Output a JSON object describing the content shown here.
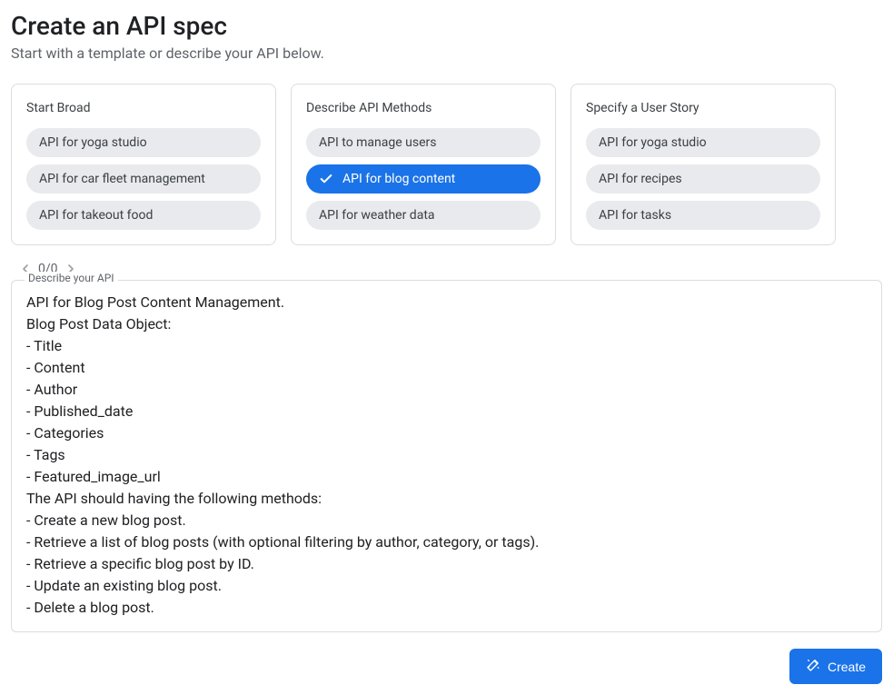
{
  "header": {
    "title": "Create an API spec",
    "subtitle": "Start with a template or describe your API below."
  },
  "cards": [
    {
      "title": "Start Broad",
      "items": [
        {
          "label": "API for yoga studio",
          "selected": false
        },
        {
          "label": "API for car fleet management",
          "selected": false
        },
        {
          "label": "API for takeout food",
          "selected": false
        }
      ]
    },
    {
      "title": "Describe API Methods",
      "items": [
        {
          "label": "API to manage users",
          "selected": false
        },
        {
          "label": "API for blog content",
          "selected": true
        },
        {
          "label": "API for weather data",
          "selected": false
        }
      ]
    },
    {
      "title": "Specify a User Story",
      "items": [
        {
          "label": "API for yoga studio",
          "selected": false
        },
        {
          "label": "API for recipes",
          "selected": false
        },
        {
          "label": "API for tasks",
          "selected": false
        }
      ]
    }
  ],
  "pager": {
    "text": "0/0"
  },
  "describe": {
    "label": "Describe your API",
    "value": "API for Blog Post Content Management.\nBlog Post Data Object:\n- Title\n- Content\n- Author\n- Published_date\n- Categories\n- Tags\n- Featured_image_url\nThe API should having the following methods:\n- Create a new blog post.\n- Retrieve a list of blog posts (with optional filtering by author, category, or tags).\n- Retrieve a specific blog post by ID.\n- Update an existing blog post.\n- Delete a blog post."
  },
  "footer": {
    "create_label": "Create"
  }
}
